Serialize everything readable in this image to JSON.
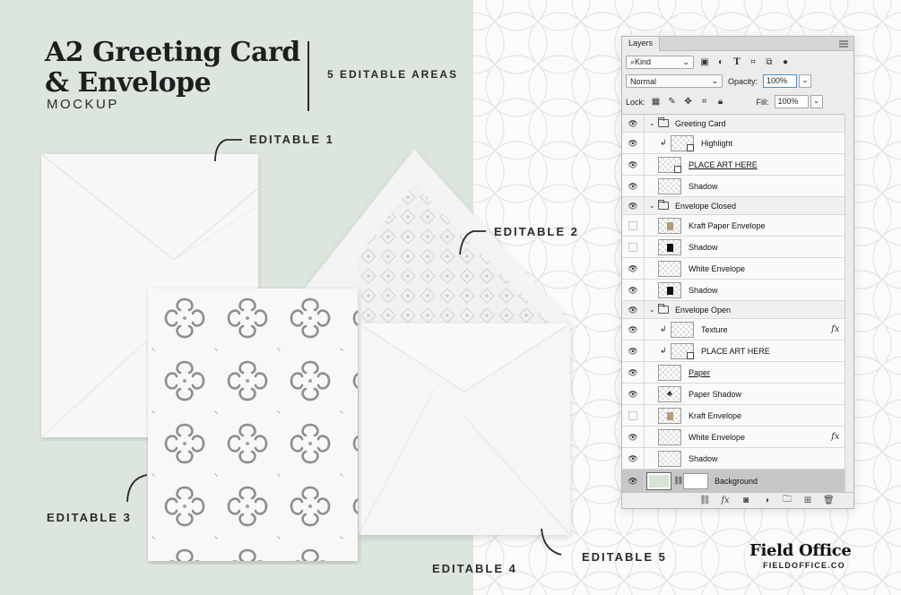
{
  "header": {
    "title_line1": "A2 Greeting Card",
    "title_line2": "& Envelope",
    "subtitle": "MOCKUP",
    "areas": "5 EDITABLE AREAS"
  },
  "callouts": [
    "EDITABLE 1",
    "EDITABLE 2",
    "EDITABLE 3",
    "EDITABLE 4",
    "EDITABLE 5"
  ],
  "brand": {
    "name": "Field Office",
    "url": "FIELDOFFICE.CO"
  },
  "colors": {
    "left_background": "#dce6dc",
    "panel": "#ececec",
    "selected_layer": "#c7c7c7",
    "focus_ring": "#4a8fd8",
    "background_swatch": "#d6e4d6"
  },
  "layers_panel": {
    "tab": "Layers",
    "filter": "Kind",
    "blend_mode": "Normal",
    "opacity_label": "Opacity:",
    "opacity": "100%",
    "lock_label": "Lock:",
    "fill_label": "Fill:",
    "fill": "100%",
    "layers": [
      {
        "name": "Greeting Card",
        "type": "group",
        "visible": true,
        "indent": 0
      },
      {
        "name": "Highlight",
        "type": "layer",
        "visible": true,
        "clipped": true,
        "smart": true
      },
      {
        "name": "PLACE ART HERE",
        "type": "layer",
        "visible": true,
        "underline": true,
        "smart": true
      },
      {
        "name": "Shadow",
        "type": "layer",
        "visible": true
      },
      {
        "name": "Envelope Closed",
        "type": "group",
        "visible": true
      },
      {
        "name": "Kraft Paper Envelope",
        "type": "layer",
        "visible": false,
        "mark": "kraft"
      },
      {
        "name": "Shadow",
        "type": "layer",
        "visible": false,
        "mark": "black"
      },
      {
        "name": "White Envelope",
        "type": "layer",
        "visible": true
      },
      {
        "name": "Shadow",
        "type": "layer",
        "visible": true,
        "mark": "black"
      },
      {
        "name": "Envelope Open",
        "type": "group",
        "visible": true
      },
      {
        "name": "Texture",
        "type": "layer",
        "visible": true,
        "clipped": true,
        "fx": true
      },
      {
        "name": "PLACE ART HERE",
        "type": "layer",
        "visible": true,
        "clipped": true,
        "smart": true
      },
      {
        "name": "Paper",
        "type": "layer",
        "visible": true,
        "underline": true
      },
      {
        "name": "Paper Shadow",
        "type": "layer",
        "visible": true,
        "mark": "club"
      },
      {
        "name": "Kraft Envelope",
        "type": "layer",
        "visible": false,
        "mark": "kraft"
      },
      {
        "name": "White Envelope",
        "type": "layer",
        "visible": true,
        "fx": true
      },
      {
        "name": "Shadow",
        "type": "layer",
        "visible": true
      },
      {
        "name": "Background",
        "type": "background",
        "visible": true,
        "selected": true
      }
    ],
    "footer_icons": [
      "link-icon",
      "fx-icon",
      "mask-icon",
      "adjustment-icon",
      "new-group-icon",
      "new-layer-icon",
      "trash-icon"
    ]
  }
}
